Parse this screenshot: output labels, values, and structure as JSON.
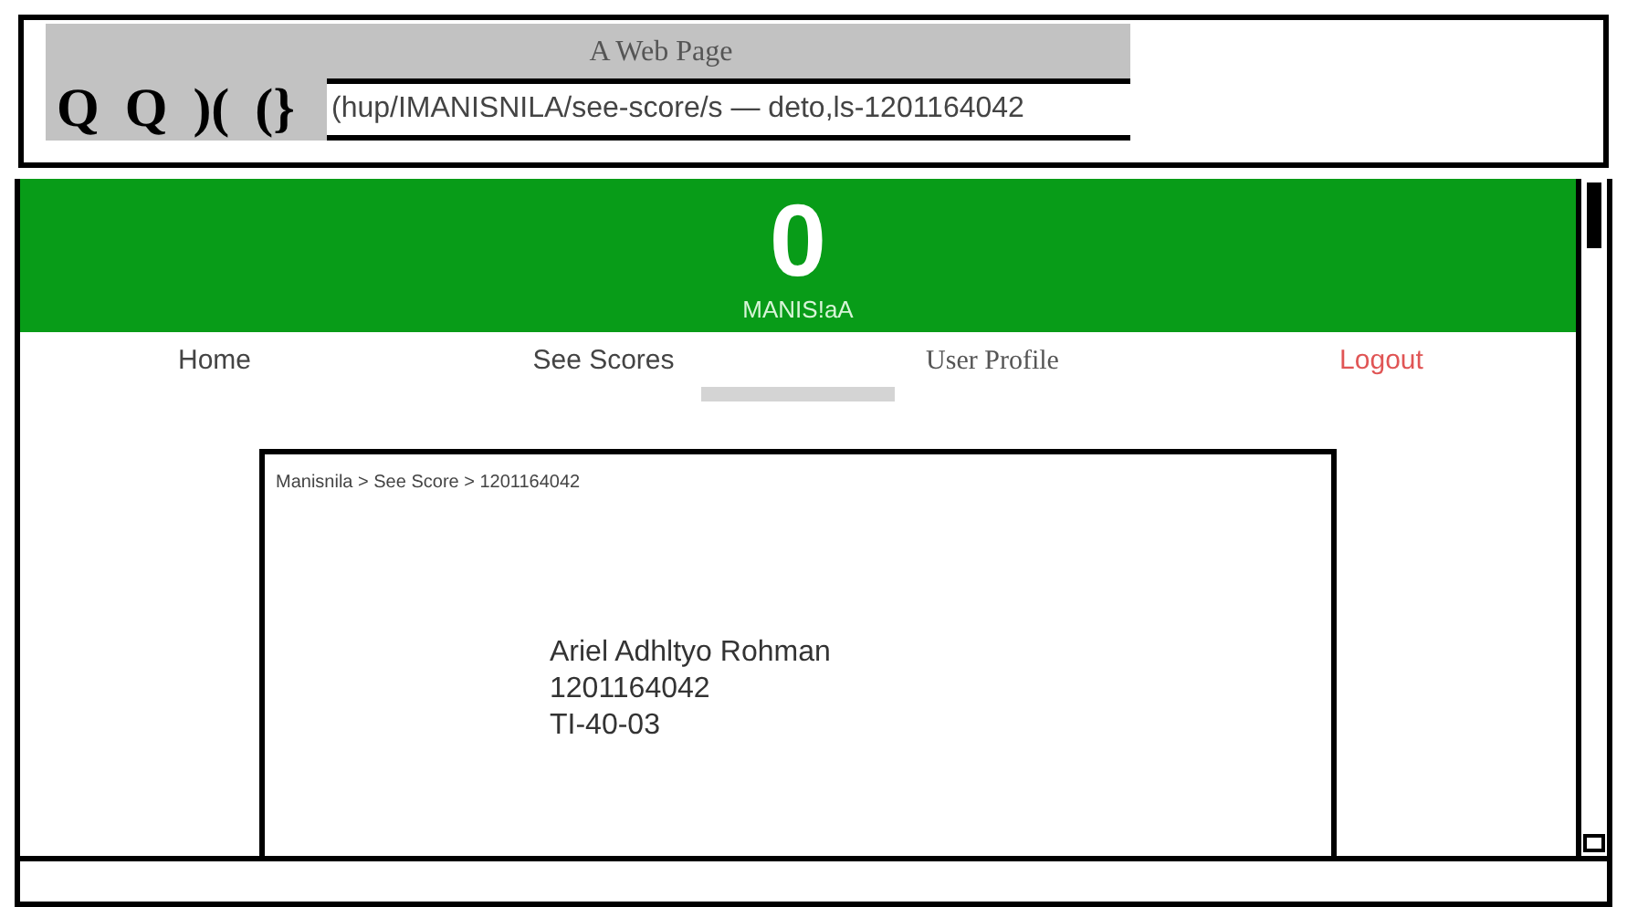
{
  "browser": {
    "title": "A Web Page",
    "toolbar_buttons": [
      "Q",
      "Q",
      ")(",
      "(}"
    ],
    "address": "(hup/IMANISNILA/see-score/s — deto,ls-1201164042"
  },
  "header": {
    "logo": "0",
    "brand": "MANIS!aA"
  },
  "nav": [
    {
      "label": "Home",
      "kind": "plain"
    },
    {
      "label": "See Scores",
      "kind": "plain"
    },
    {
      "label": "User Profile",
      "kind": "serif"
    },
    {
      "label": "Logout",
      "kind": "danger"
    }
  ],
  "card": {
    "breadcrumb": "Manisnila > See Score > 1201164042",
    "lines": [
      "Ariel Adhltyo Rohman",
      "1201164042",
      "TI-40-03"
    ]
  }
}
